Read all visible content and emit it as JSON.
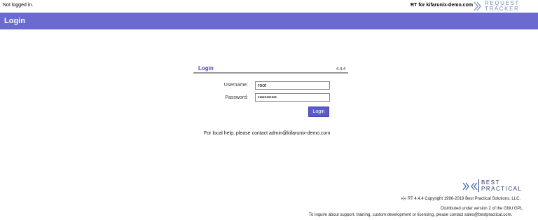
{
  "topbar": {
    "status": "Not logged in.",
    "site": "RT for kifarunix-demo.com",
    "logo_line1": "REQUEST",
    "logo_line2": "TRACKER"
  },
  "header": {
    "title": "Login"
  },
  "login_box": {
    "title": "Login",
    "version": "4.4.4",
    "username_label": "Username:",
    "username_value": "root",
    "password_label": "Password:",
    "password_mask": "•••••••••••",
    "button_label": "Login"
  },
  "help_text": "For local help, please contact admin@kifarunix-demo.com",
  "footer": {
    "logo_line1": "BEST",
    "logo_line2": "PRACTICAL",
    "copyright": "»|« RT 4.4.4 Copyright 1996-2019 Best Practical Solutions, LLC.",
    "gpl": "Distributed under version 2 of the GNU GPL.",
    "inquire": "To inquire about support, training, custom development or licensing, please contact sales@bestpractical.com."
  },
  "colors": {
    "header_band": "#6a6ad0",
    "button": "#5a5ac8",
    "box_title": "#4a4ab8"
  },
  "icons": [
    "request-tracker-logo-icon",
    "best-practical-logo-icon"
  ]
}
